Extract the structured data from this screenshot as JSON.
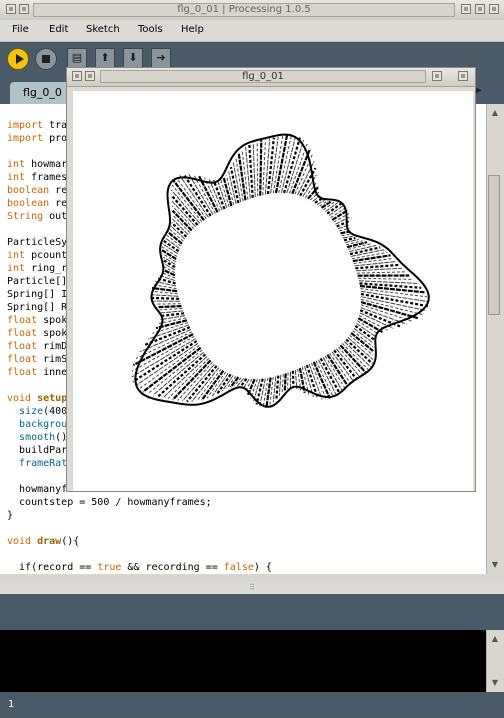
{
  "window": {
    "title": "flg_0_01 | Processing 1.0.5"
  },
  "menu": [
    "File",
    "Edit",
    "Sketch",
    "Tools",
    "Help"
  ],
  "toolbar": {
    "icons": [
      "run-icon",
      "stop-icon",
      "new-icon",
      "open-icon",
      "save-icon",
      "export-icon"
    ]
  },
  "tab": {
    "label": "flg_0_0",
    "arrow": "▶"
  },
  "sketch_window": {
    "title": "flg_0_01"
  },
  "editor": {
    "lines": [
      {
        "parts": [
          [
            "kw",
            "import"
          ],
          [
            "",
            " tra"
          ]
        ]
      },
      {
        "parts": [
          [
            "kw",
            "import"
          ],
          [
            "",
            " pro"
          ]
        ]
      },
      {
        "parts": []
      },
      {
        "parts": [
          [
            "kw",
            "int"
          ],
          [
            "",
            " howmar"
          ]
        ]
      },
      {
        "parts": [
          [
            "kw",
            "int"
          ],
          [
            "",
            " frames"
          ]
        ]
      },
      {
        "parts": [
          [
            "kw",
            "boolean"
          ],
          [
            "",
            " re"
          ]
        ]
      },
      {
        "parts": [
          [
            "kw",
            "boolean"
          ],
          [
            "",
            " re"
          ]
        ]
      },
      {
        "parts": [
          [
            "kw",
            "String"
          ],
          [
            "",
            " out"
          ]
        ]
      },
      {
        "parts": []
      },
      {
        "parts": [
          [
            "",
            "ParticleSy"
          ]
        ]
      },
      {
        "parts": [
          [
            "kw",
            "int"
          ],
          [
            "",
            " pcount"
          ]
        ]
      },
      {
        "parts": [
          [
            "kw",
            "int"
          ],
          [
            "",
            " ring_r"
          ]
        ]
      },
      {
        "parts": [
          [
            "",
            "Particle[]"
          ]
        ]
      },
      {
        "parts": [
          [
            "",
            "Spring[] I"
          ]
        ]
      },
      {
        "parts": [
          [
            "",
            "Spring[] R"
          ]
        ]
      },
      {
        "parts": [
          [
            "kw",
            "float"
          ],
          [
            "",
            " spok"
          ]
        ]
      },
      {
        "parts": [
          [
            "kw",
            "float"
          ],
          [
            "",
            " spok"
          ]
        ]
      },
      {
        "parts": [
          [
            "kw",
            "float"
          ],
          [
            "",
            " rimD"
          ]
        ]
      },
      {
        "parts": [
          [
            "kw",
            "float"
          ],
          [
            "",
            " rimS"
          ]
        ]
      },
      {
        "parts": [
          [
            "kw",
            "float"
          ],
          [
            "",
            " inne"
          ]
        ]
      },
      {
        "parts": []
      },
      {
        "parts": [
          [
            "kw",
            "void"
          ],
          [
            "",
            " "
          ],
          [
            "fn",
            "setup"
          ]
        ]
      },
      {
        "parts": [
          [
            "",
            "  "
          ],
          [
            "kw2",
            "size"
          ],
          [
            "",
            "(400"
          ]
        ]
      },
      {
        "parts": [
          [
            "",
            "  "
          ],
          [
            "kw2",
            "backgrou"
          ]
        ]
      },
      {
        "parts": [
          [
            "",
            "  "
          ],
          [
            "kw2",
            "smooth"
          ],
          [
            "",
            "()"
          ]
        ]
      },
      {
        "parts": [
          [
            "",
            "  buildPar"
          ]
        ]
      },
      {
        "parts": [
          [
            "",
            "  "
          ],
          [
            "kw2",
            "frameRat"
          ]
        ]
      },
      {
        "parts": []
      },
      {
        "parts": [
          [
            "",
            "  howmanyf"
          ]
        ]
      },
      {
        "parts": [
          [
            "",
            "  countstep = 500 / howmanyframes;"
          ]
        ]
      },
      {
        "parts": [
          [
            "",
            "}"
          ]
        ]
      },
      {
        "parts": []
      },
      {
        "parts": [
          [
            "kw",
            "void"
          ],
          [
            "",
            " "
          ],
          [
            "fn",
            "draw"
          ],
          [
            "",
            "(){"
          ]
        ]
      },
      {
        "parts": []
      },
      {
        "parts": [
          [
            "",
            "  if(record == "
          ],
          [
            "lit",
            "true"
          ],
          [
            "",
            " && recording == "
          ],
          [
            "lit",
            "false"
          ],
          [
            "",
            ") {"
          ]
        ]
      }
    ]
  },
  "status": {
    "splitter": "⠿",
    "line_number": "1"
  }
}
